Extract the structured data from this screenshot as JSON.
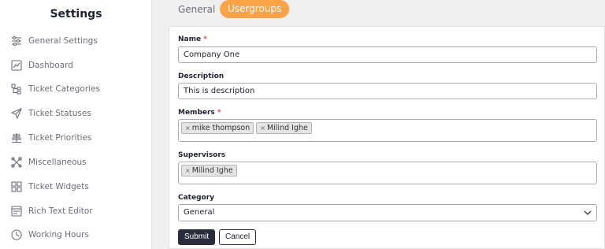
{
  "sidebar": {
    "title": "Settings",
    "items": [
      {
        "label": "General Settings",
        "icon": "sliders-icon"
      },
      {
        "label": "Dashboard",
        "icon": "chart-icon"
      },
      {
        "label": "Ticket Categories",
        "icon": "tree-icon"
      },
      {
        "label": "Ticket Statuses",
        "icon": "send-icon"
      },
      {
        "label": "Ticket Priorities",
        "icon": "priority-icon"
      },
      {
        "label": "Miscellaneous",
        "icon": "tools-icon"
      },
      {
        "label": "Ticket Widgets",
        "icon": "widgets-icon"
      },
      {
        "label": "Rich Text Editor",
        "icon": "editor-icon"
      },
      {
        "label": "Working Hours",
        "icon": "clock-icon"
      }
    ]
  },
  "tabs": {
    "general": "General",
    "usergroups": "Usergroups",
    "active_color": "#fba346"
  },
  "form": {
    "name": {
      "label": "Name",
      "required_mark": "*",
      "value": "Company One"
    },
    "description": {
      "label": "Description",
      "value": "This is description"
    },
    "members": {
      "label": "Members",
      "required_mark": "*",
      "tags": [
        "mike thompson",
        "Milind Ighe"
      ]
    },
    "supervisors": {
      "label": "Supervisors",
      "tags": [
        "Milind Ighe"
      ]
    },
    "category": {
      "label": "Category",
      "value": "General"
    },
    "tag_remove": "×",
    "submit_label": "Submit",
    "cancel_label": "Cancel"
  }
}
